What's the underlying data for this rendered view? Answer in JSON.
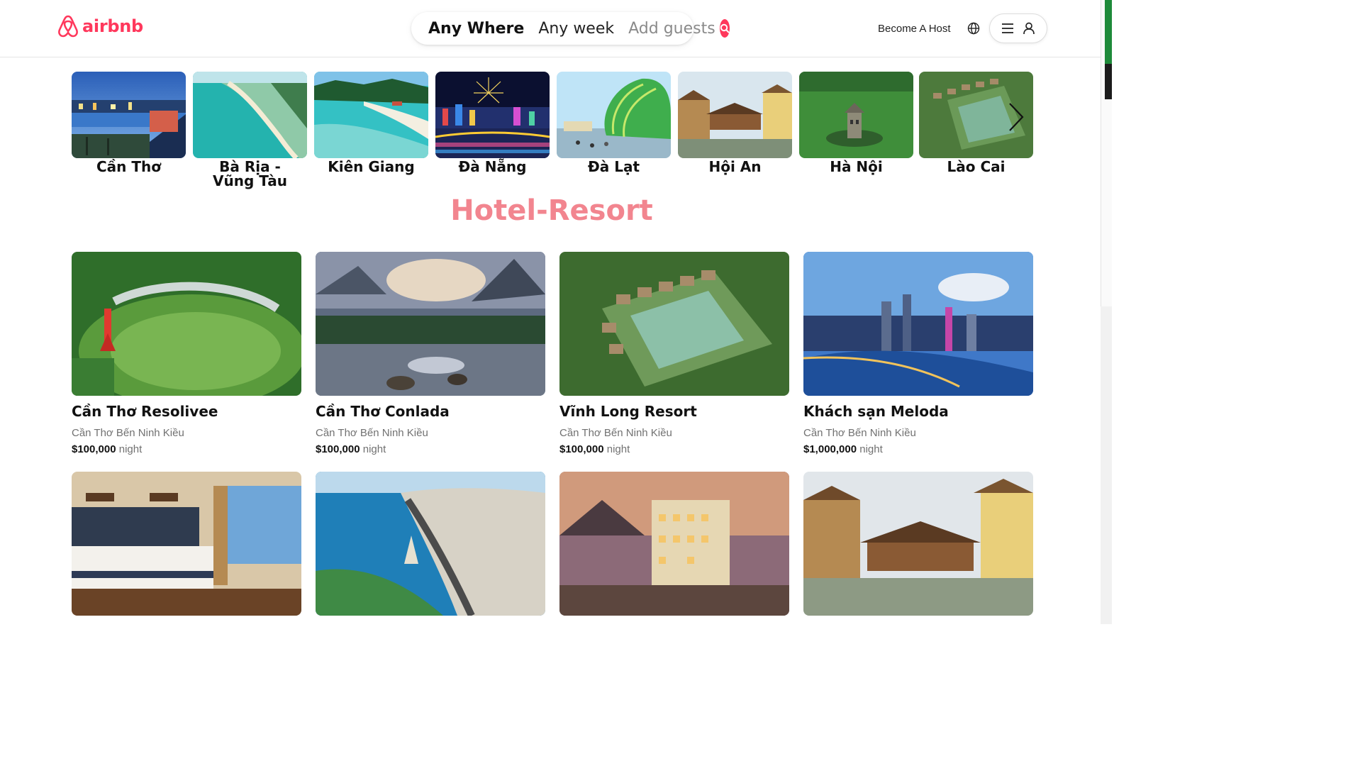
{
  "header": {
    "logo_text": "airbnb",
    "brand_color": "#ff385c",
    "search": {
      "anywhere": "Any Where",
      "week": "Any week",
      "guests": "Add guests"
    },
    "become_host": "Become A Host"
  },
  "destinations": [
    {
      "label": "Cần Thơ",
      "scene": "city-river-night"
    },
    {
      "label": "Bà Rịa - Vũng Tàu",
      "scene": "beach-coast"
    },
    {
      "label": "Kiên Giang",
      "scene": "beach-white-sand"
    },
    {
      "label": "Đà Nẵng",
      "scene": "fireworks-bridge"
    },
    {
      "label": "Đà Lạt",
      "scene": "green-dome"
    },
    {
      "label": "Hội An",
      "scene": "old-bridge"
    },
    {
      "label": "Hà Nội",
      "scene": "lake-tower"
    },
    {
      "label": "Lào Cai",
      "scene": "resort-aerial"
    }
  ],
  "section_title": "Hotel-Resort",
  "listings": [
    {
      "name": "Cần Thơ Resolivee",
      "location": "Cần Thơ Bến Ninh Kiều",
      "price": "$100,000",
      "unit": "night",
      "scene": "park-aerial"
    },
    {
      "name": "Cần Thơ Conlada",
      "location": "Cần Thơ Bến Ninh Kiều",
      "price": "$100,000",
      "unit": "night",
      "scene": "mountain-river"
    },
    {
      "name": "Vĩnh Long Resort",
      "location": "Cần Thơ Bến Ninh Kiều",
      "price": "$100,000",
      "unit": "night",
      "scene": "resort-aerial"
    },
    {
      "name": "Khách sạn Meloda",
      "location": "Cần Thơ Bến Ninh Kiều",
      "price": "$1,000,000",
      "unit": "night",
      "scene": "city-skyline"
    },
    {
      "name": "",
      "location": "",
      "price": "",
      "unit": "",
      "scene": "hotel-room"
    },
    {
      "name": "",
      "location": "",
      "price": "",
      "unit": "",
      "scene": "coastal-city"
    },
    {
      "name": "",
      "location": "",
      "price": "",
      "unit": "",
      "scene": "hotel-building"
    },
    {
      "name": "",
      "location": "",
      "price": "",
      "unit": "",
      "scene": "old-bridge"
    }
  ]
}
